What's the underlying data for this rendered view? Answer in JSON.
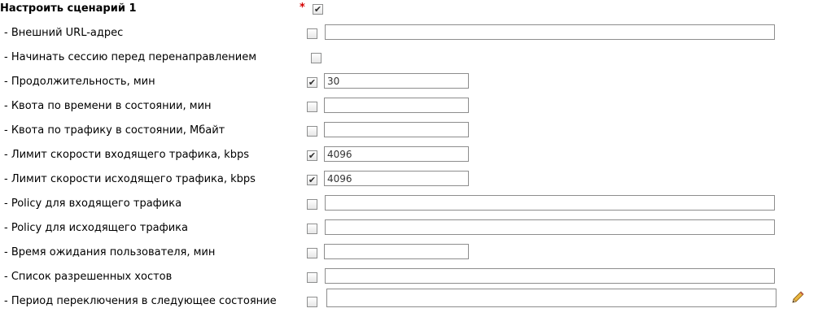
{
  "scenario": {
    "title": "Настроить сценарий 1",
    "required_mark": "*",
    "enabled": true
  },
  "rows": [
    {
      "label": "- Внешний URL-адрес",
      "checked": false,
      "value": ""
    },
    {
      "label": "- Начинать сессию перед перенаправлением",
      "checked": false
    },
    {
      "label": "- Продолжительность, мин",
      "checked": true,
      "value": "30"
    },
    {
      "label": "- Квота по времени в состоянии, мин",
      "checked": false,
      "value": ""
    },
    {
      "label": "- Квота по трафику в состоянии, Мбайт",
      "checked": false,
      "value": ""
    },
    {
      "label": "- Лимит скорости входящего трафика, kbps",
      "checked": true,
      "value": "4096"
    },
    {
      "label": "- Лимит скорости исходящего трафика, kbps",
      "checked": true,
      "value": "4096"
    },
    {
      "label": "- Policy для входящего трафика",
      "checked": false,
      "value": ""
    },
    {
      "label": "- Policy для исходящего трафика",
      "checked": false,
      "value": ""
    },
    {
      "label": "- Время ожидания пользователя, мин",
      "checked": false,
      "value": ""
    },
    {
      "label": "- Список разрешенных хостов",
      "checked": false,
      "value": ""
    },
    {
      "label": "- Период переключения в следующее состояние",
      "checked": false,
      "value": ""
    }
  ],
  "icons": {
    "edit": "pencil-icon"
  }
}
